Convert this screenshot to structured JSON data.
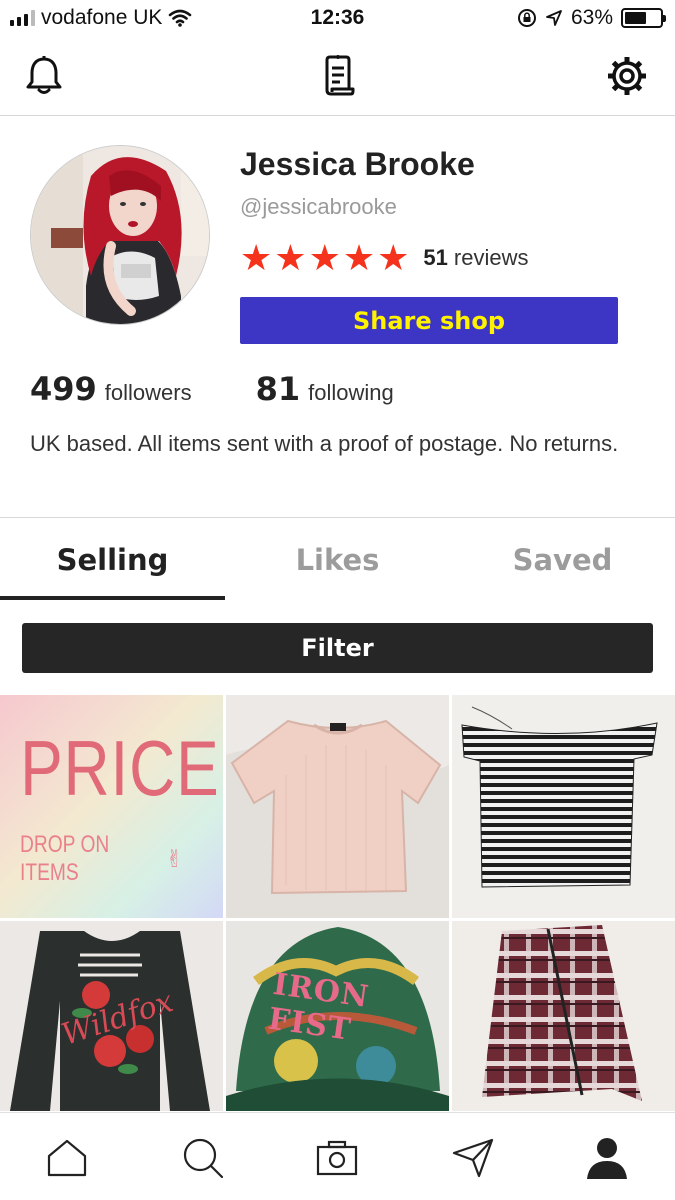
{
  "status_bar": {
    "carrier": "vodafone UK",
    "time": "12:36",
    "battery": "63%",
    "battery_level": 0.63
  },
  "top_nav": {
    "left_icon": "bell-icon",
    "center_icon": "receipt-icon",
    "right_icon": "gear-icon"
  },
  "profile": {
    "name": "Jessica Brooke",
    "handle": "@jessicabrooke",
    "rating_stars": 5,
    "reviews_count": "51",
    "reviews_label": "reviews",
    "share_button": "Share shop",
    "followers_count": "499",
    "followers_label": "followers",
    "following_count": "81",
    "following_label": "following",
    "bio": "UK based. All items sent with a proof of postage. No returns."
  },
  "tabs": [
    {
      "label": "Selling",
      "active": true
    },
    {
      "label": "Likes",
      "active": false
    },
    {
      "label": "Saved",
      "active": false
    }
  ],
  "filter_button": "Filter",
  "items": [
    {
      "kind": "promo",
      "title": "PRICE",
      "subtitle": "DROP ON ITEMS"
    },
    {
      "kind": "photo",
      "name": "pink-tshirt"
    },
    {
      "kind": "photo",
      "name": "striped-top"
    },
    {
      "kind": "photo",
      "name": "wildfox-sweater",
      "print_text": "Wildfox"
    },
    {
      "kind": "photo",
      "name": "iron-fist-cap",
      "print_text": "IRON FIST"
    },
    {
      "kind": "photo",
      "name": "plaid-skirt"
    }
  ],
  "colors": {
    "accent": "#3d35c4",
    "accent_text": "#fff200",
    "star": "#f5331c",
    "dark": "#262626"
  },
  "bottom_nav": [
    "home-icon",
    "search-icon",
    "camera-icon",
    "send-icon",
    "profile-icon"
  ]
}
